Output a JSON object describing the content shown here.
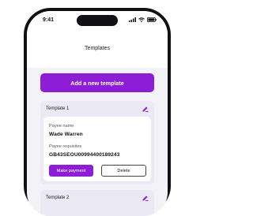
{
  "status_bar": {
    "time": "9:41"
  },
  "header": {
    "title": "Templates"
  },
  "add_button": {
    "label": "Add a new template"
  },
  "templates": [
    {
      "title": "Template 1",
      "payee_name_label": "Payee name",
      "payee_name": "Wade Warren",
      "payee_requisites_label": "Payee requisites",
      "payee_requisites": "GB43SEOU00994400189243",
      "make_payment_label": "Make payment",
      "delete_label": "Delete"
    },
    {
      "title": "Template 2"
    }
  ],
  "colors": {
    "accent": "#8e1ed6",
    "card_bg": "#ebe9f3",
    "screen_bg": "#f3f2f7"
  },
  "icons": {
    "edit": "edit-pencil-icon"
  }
}
